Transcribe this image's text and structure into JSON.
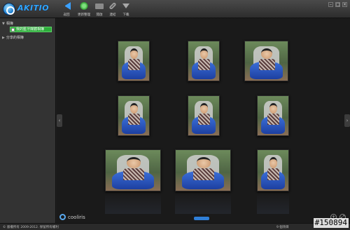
{
  "app": {
    "logo_text": "AKITIO",
    "toolbar": [
      {
        "label": "返回",
        "icon": "back-arrow-icon"
      },
      {
        "label": "更新整理",
        "icon": "refresh-icon"
      },
      {
        "label": "開啟",
        "icon": "folder-icon"
      },
      {
        "label": "連結",
        "icon": "link-icon"
      },
      {
        "label": "下載",
        "icon": "download-icon"
      }
    ]
  },
  "sidebar": {
    "section_photos": "相簿",
    "selected_album": "我的藍牙媒體相簿",
    "section_shared": "分享的相簿"
  },
  "viewer": {
    "brand": "cooliris",
    "photo_count": 9,
    "prev_icon": "‹",
    "next_icon": "›"
  },
  "statusbar": {
    "copyright": "© 版權所有 2009-2012. 保留所有權利",
    "selection": "9 個項目"
  },
  "watermark": "#150894"
}
